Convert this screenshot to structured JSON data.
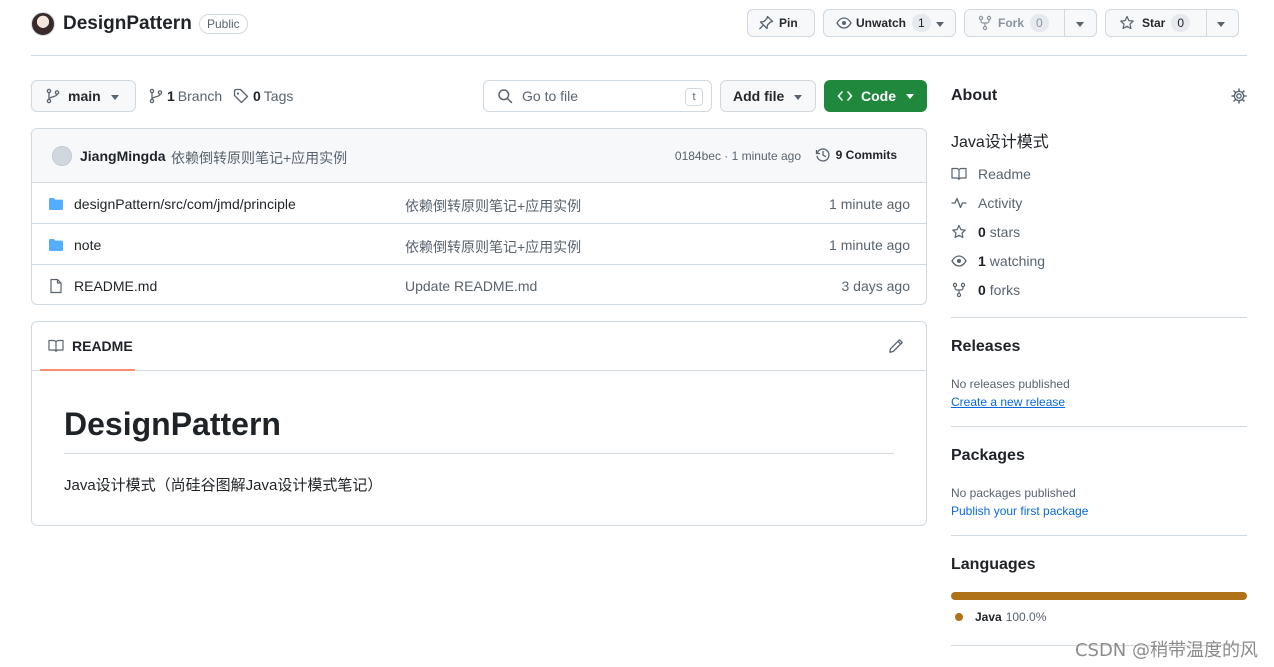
{
  "header": {
    "repo_name": "DesignPattern",
    "visibility": "Public",
    "pin_label": "Pin",
    "unwatch_label": "Unwatch",
    "watch_count": "1",
    "fork_label": "Fork",
    "fork_count": "0",
    "star_label": "Star",
    "star_count": "0"
  },
  "toolbar": {
    "branch": "main",
    "branches_count": "1",
    "branches_label": "Branch",
    "tags_count": "0",
    "tags_label": "Tags",
    "search_placeholder": "Go to file",
    "search_shortcut": "t",
    "add_file_label": "Add file",
    "code_label": "Code"
  },
  "commit": {
    "author": "JiangMingda",
    "message": "依赖倒转原则笔记+应用实例",
    "sha_time": "0184bec · 1 minute ago",
    "commits_count": "9",
    "commits_label": "Commits"
  },
  "files": [
    {
      "icon": "folder-icon",
      "name": "designPattern/src/com/jmd/principle",
      "message": "依赖倒转原则笔记+应用实例",
      "date": "1 minute ago"
    },
    {
      "icon": "folder-icon",
      "name": "note",
      "message": "依赖倒转原则笔记+应用实例",
      "date": "1 minute ago"
    },
    {
      "icon": "file-icon",
      "name": "README.md",
      "message": "Update README.md",
      "date": "3 days ago"
    }
  ],
  "readme": {
    "tab_label": "README",
    "heading": "DesignPattern",
    "body": "Java设计模式（尚硅谷图解Java设计模式笔记）"
  },
  "sidebar": {
    "about_title": "About",
    "description": "Java设计模式",
    "readme_label": "Readme",
    "activity_label": "Activity",
    "stars_count": "0",
    "stars_label": "stars",
    "watching_count": "1",
    "watching_label": "watching",
    "forks_count": "0",
    "forks_label": "forks",
    "releases_title": "Releases",
    "releases_empty": "No releases published",
    "releases_link": "Create a new release",
    "packages_title": "Packages",
    "packages_empty": "No packages published",
    "packages_link": "Publish your first package",
    "languages_title": "Languages",
    "languages": [
      {
        "name": "Java",
        "percent": "100.0%",
        "color": "#b07219"
      }
    ]
  },
  "watermark": "CSDN @稍带温度的风",
  "colors": {
    "accent_green": "#1f883d",
    "link_blue": "#0969da",
    "java": "#b07219",
    "tab_underline": "#fd8c73"
  }
}
